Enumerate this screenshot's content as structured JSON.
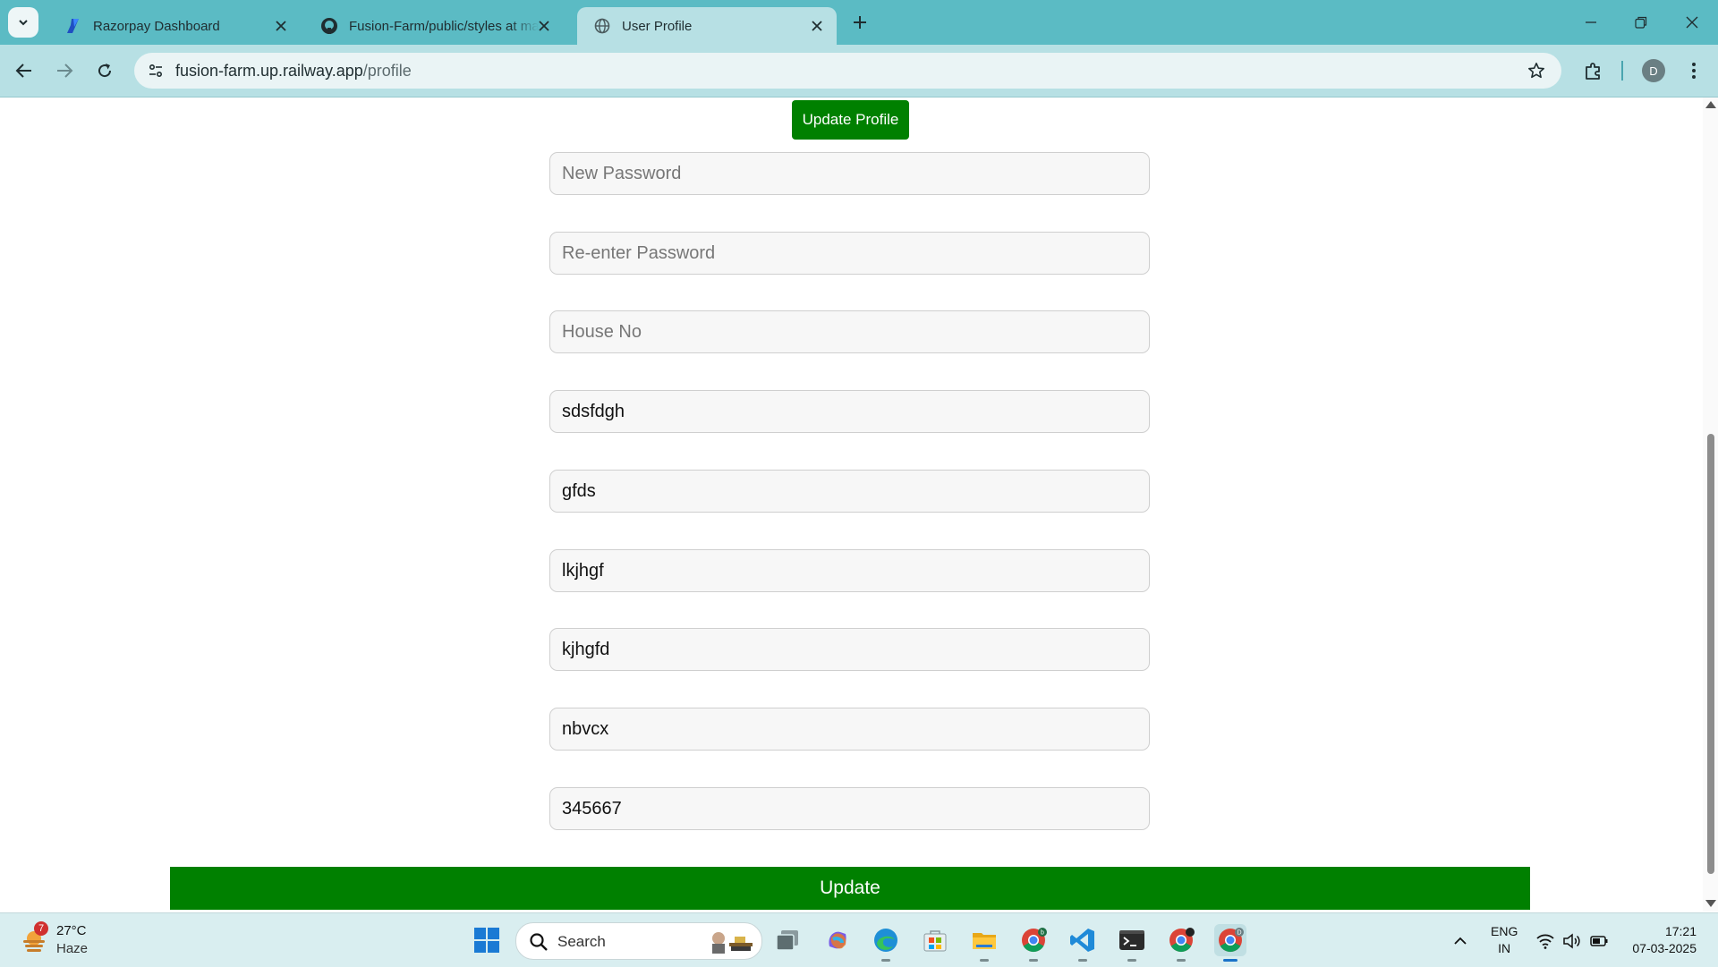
{
  "browser": {
    "tabs": [
      {
        "title": "Razorpay Dashboard",
        "active": false
      },
      {
        "title": "Fusion-Farm/public/styles at main",
        "active": false
      },
      {
        "title": "User Profile",
        "active": true
      }
    ],
    "url_host": "fusion-farm.up.railway.app",
    "url_path": "/profile",
    "profile_initial": "D"
  },
  "page": {
    "update_profile_label": "Update Profile",
    "fields": [
      {
        "placeholder": "New Password",
        "value": ""
      },
      {
        "placeholder": "Re-enter Password",
        "value": ""
      },
      {
        "placeholder": "House No",
        "value": ""
      },
      {
        "placeholder": "",
        "value": "sdsfdgh"
      },
      {
        "placeholder": "",
        "value": "gfds"
      },
      {
        "placeholder": "",
        "value": "lkjhgf"
      },
      {
        "placeholder": "",
        "value": "kjhgfd"
      },
      {
        "placeholder": "",
        "value": "nbvcx"
      },
      {
        "placeholder": "",
        "value": "345667"
      }
    ],
    "update_label": "Update",
    "accent_color": "#008000"
  },
  "taskbar": {
    "weather": {
      "temp": "27°C",
      "condition": "Haze",
      "badge": "7"
    },
    "search_label": "Search",
    "language": "ENG",
    "region": "IN",
    "time": "17:21",
    "date": "07-03-2025"
  }
}
